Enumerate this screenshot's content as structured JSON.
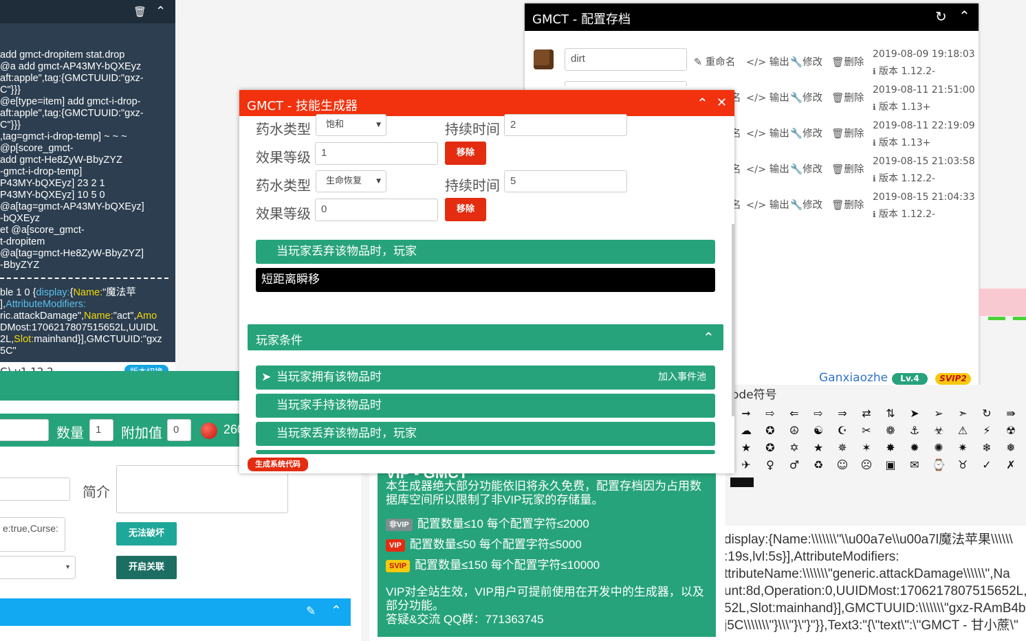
{
  "console": {
    "lines": [
      "add gmct-dropitem stat.drop",
      " @a add gmct-AP43MY-bQXEyz",
      "aft:apple\",tag:{GMCTUUID:\"gxz-",
      "C\"}}}",
      " @e[type=item] add gmct-i-drop-",
      "aft:apple\",tag:{GMCTUUID:\"gxz-",
      "C\"}}}",
      ",tag=gmct-i-drop-temp] ~ ~ ~",
      " @p[score_gmct-",
      "add gmct-He8ZyW-BbyZYZ",
      "-gmct-i-drop-temp]",
      "P43MY-bQXEyz] 23 2 1",
      "P43MY-bQXEyz] 10 5 0",
      " @a[tag=gmct-AP43MY-bQXEyz]",
      "-bQXEyz",
      "et @a[score_gmct-",
      "t-dropitem",
      " @a[tag=gmct-He8ZyW-BbyZYZ]",
      "-BbyZYZ"
    ],
    "nbt": {
      "l1a": "ble 1 0 {",
      "l1b": "display:",
      "l1c": "{",
      "l1d": "Name:",
      "l1e": "\"魔法苹",
      "l2a": "],",
      "l2b": "AttributeModifiers:",
      "l3a": "ric.attackDamage\",",
      "l3b": "Name:",
      "l3c": "\"act\",",
      "l3d": "Amo",
      "l4a": "DMost:1706217807515652L,UUIDL",
      "l5a": "2L,",
      "l5b": "Slot:",
      "l5c": "mainhand}],GMCTUUID:\"gxz",
      "l6a": "5C\""
    },
    "footer_version": "C) v1.12.2-",
    "switch_btn": "版本切换"
  },
  "form": {
    "qty_label": "数量",
    "qty_value": "1",
    "extra_label": "附加值",
    "extra_value": "0",
    "count": "260",
    "intro_label": "简介",
    "ench_value": "e:true,Curse:",
    "unbreakable_btn": "无法破坏",
    "link_btn": "开启关联"
  },
  "archive": {
    "title": "GMCT - 配置存档",
    "first_name": "dirt",
    "ops": {
      "rename": "重命名",
      "export": "输出",
      "edit": "修改",
      "delete": "删除",
      "rename_cut": "名"
    },
    "rows": [
      {
        "date": "2019-08-09 19:18:03",
        "version": "版本 1.12.2-"
      },
      {
        "date": "2019-08-11 21:51:00",
        "version": "版本 1.13+"
      },
      {
        "date": "2019-08-11 22:19:09",
        "version": "版本 1.13+"
      },
      {
        "date": "2019-08-15 21:03:58",
        "version": "版本 1.12.2-"
      },
      {
        "date": "2019-08-15 21:04:33",
        "version": "版本 1.12.2-"
      }
    ],
    "user": "Ganxiaozhe",
    "level": "Lv.4",
    "svip": "SVIP2"
  },
  "skill": {
    "title": "GMCT - 技能生成器",
    "effects": [
      {
        "type_label": "药水类型",
        "type_value": "饱和",
        "dur_label": "持续时间",
        "dur_value": "2",
        "lvl_label": "效果等级",
        "lvl_value": "1",
        "remove": "移除"
      },
      {
        "type_label": "药水类型",
        "type_value": "生命恢复",
        "dur_label": "持续时间",
        "dur_value": "5",
        "lvl_label": "效果等级",
        "lvl_value": "0",
        "remove": "移除"
      }
    ],
    "trigger_drop": "当玩家丢弃该物品时，玩家",
    "action_teleport": "短距离瞬移",
    "player_cond": "玩家条件",
    "cond_items": [
      "当玩家拥有该物品时",
      "当玩家手持该物品时",
      "当玩家丢弃该物品时，玩家"
    ],
    "add_pool": "加入事件池",
    "gen_code": "生成系统代码"
  },
  "vip": {
    "top_cut": "VIP - GMCT",
    "desc1": "本生成器绝大部分功能依旧将永久免费，配置存档因为占用数",
    "desc2": "据库空间所以限制了非VIP玩家的存储量。",
    "nonvip_tag": "非VIP",
    "nonvip_text": "配置数量≤10 每个配置字符≤2000",
    "vip_tag": "VIP",
    "vip_text": "配置数量≤50 每个配置字符≤5000",
    "svip_tag": "SVIP",
    "svip_text": "配置数量≤150 每个配置字符≤10000",
    "note1": "VIP对全站生效，VIP用户可提前使用在开发中的生成器，以及",
    "note2": "部分功能。",
    "qq": "答疑&交流 QQ群：771363745"
  },
  "unicode": {
    "title": "ode符号",
    "rows": [
      [
        "➞",
        "⇨",
        "⇐",
        "⇨",
        "⇒",
        "⇄",
        "⇅",
        "➤",
        "➢",
        "➣",
        "↻",
        "⇛"
      ],
      [
        "☁",
        "✪",
        "☮",
        "☯",
        "☪",
        "✂",
        "❁",
        "⚓",
        "☣",
        "⚠",
        "⚡",
        "☢"
      ],
      [
        "★",
        "✪",
        "✡",
        "★",
        "✵",
        "✶",
        "✸",
        "✹",
        "✺",
        "✷",
        "❄",
        "❅"
      ],
      [
        "✈",
        "♀",
        "♂",
        "♻",
        "☺",
        "☹",
        "▣",
        "✉",
        "⌚",
        "♉",
        "✓",
        "✗"
      ]
    ]
  },
  "nbt_right": {
    "lines": [
      "display:{Name:\\\\\\\\\\\\\\\"\\\\u00a7e\\\\u00a7l魔法苹果\\\\\\\\\\\\",
      ":19s,lvl:5s}],AttributeModifiers:",
      "ttributeName:\\\\\\\\\\\\\\\"generic.attackDamage\\\\\\\\\\\\\",Na",
      "unt:8d,Operation:0,UUIDMost:1706217807515652L,UU",
      "52L,Slot:mainhand}],GMCTUUID:\\\\\\\\\\\\\\\"gxz-RAmB4b-4",
      "j5C\\\\\\\\\\\\\\\"}\\\\\\\"}\\\"}\"}},Text3:\"{\\\"text\\\":\\\"GMCT - 甘小蔗\\\""
    ]
  },
  "colors": {
    "green": "#26a37a",
    "red": "#f2310e",
    "dark": "#2c3e50",
    "blue": "#12a9f2"
  }
}
